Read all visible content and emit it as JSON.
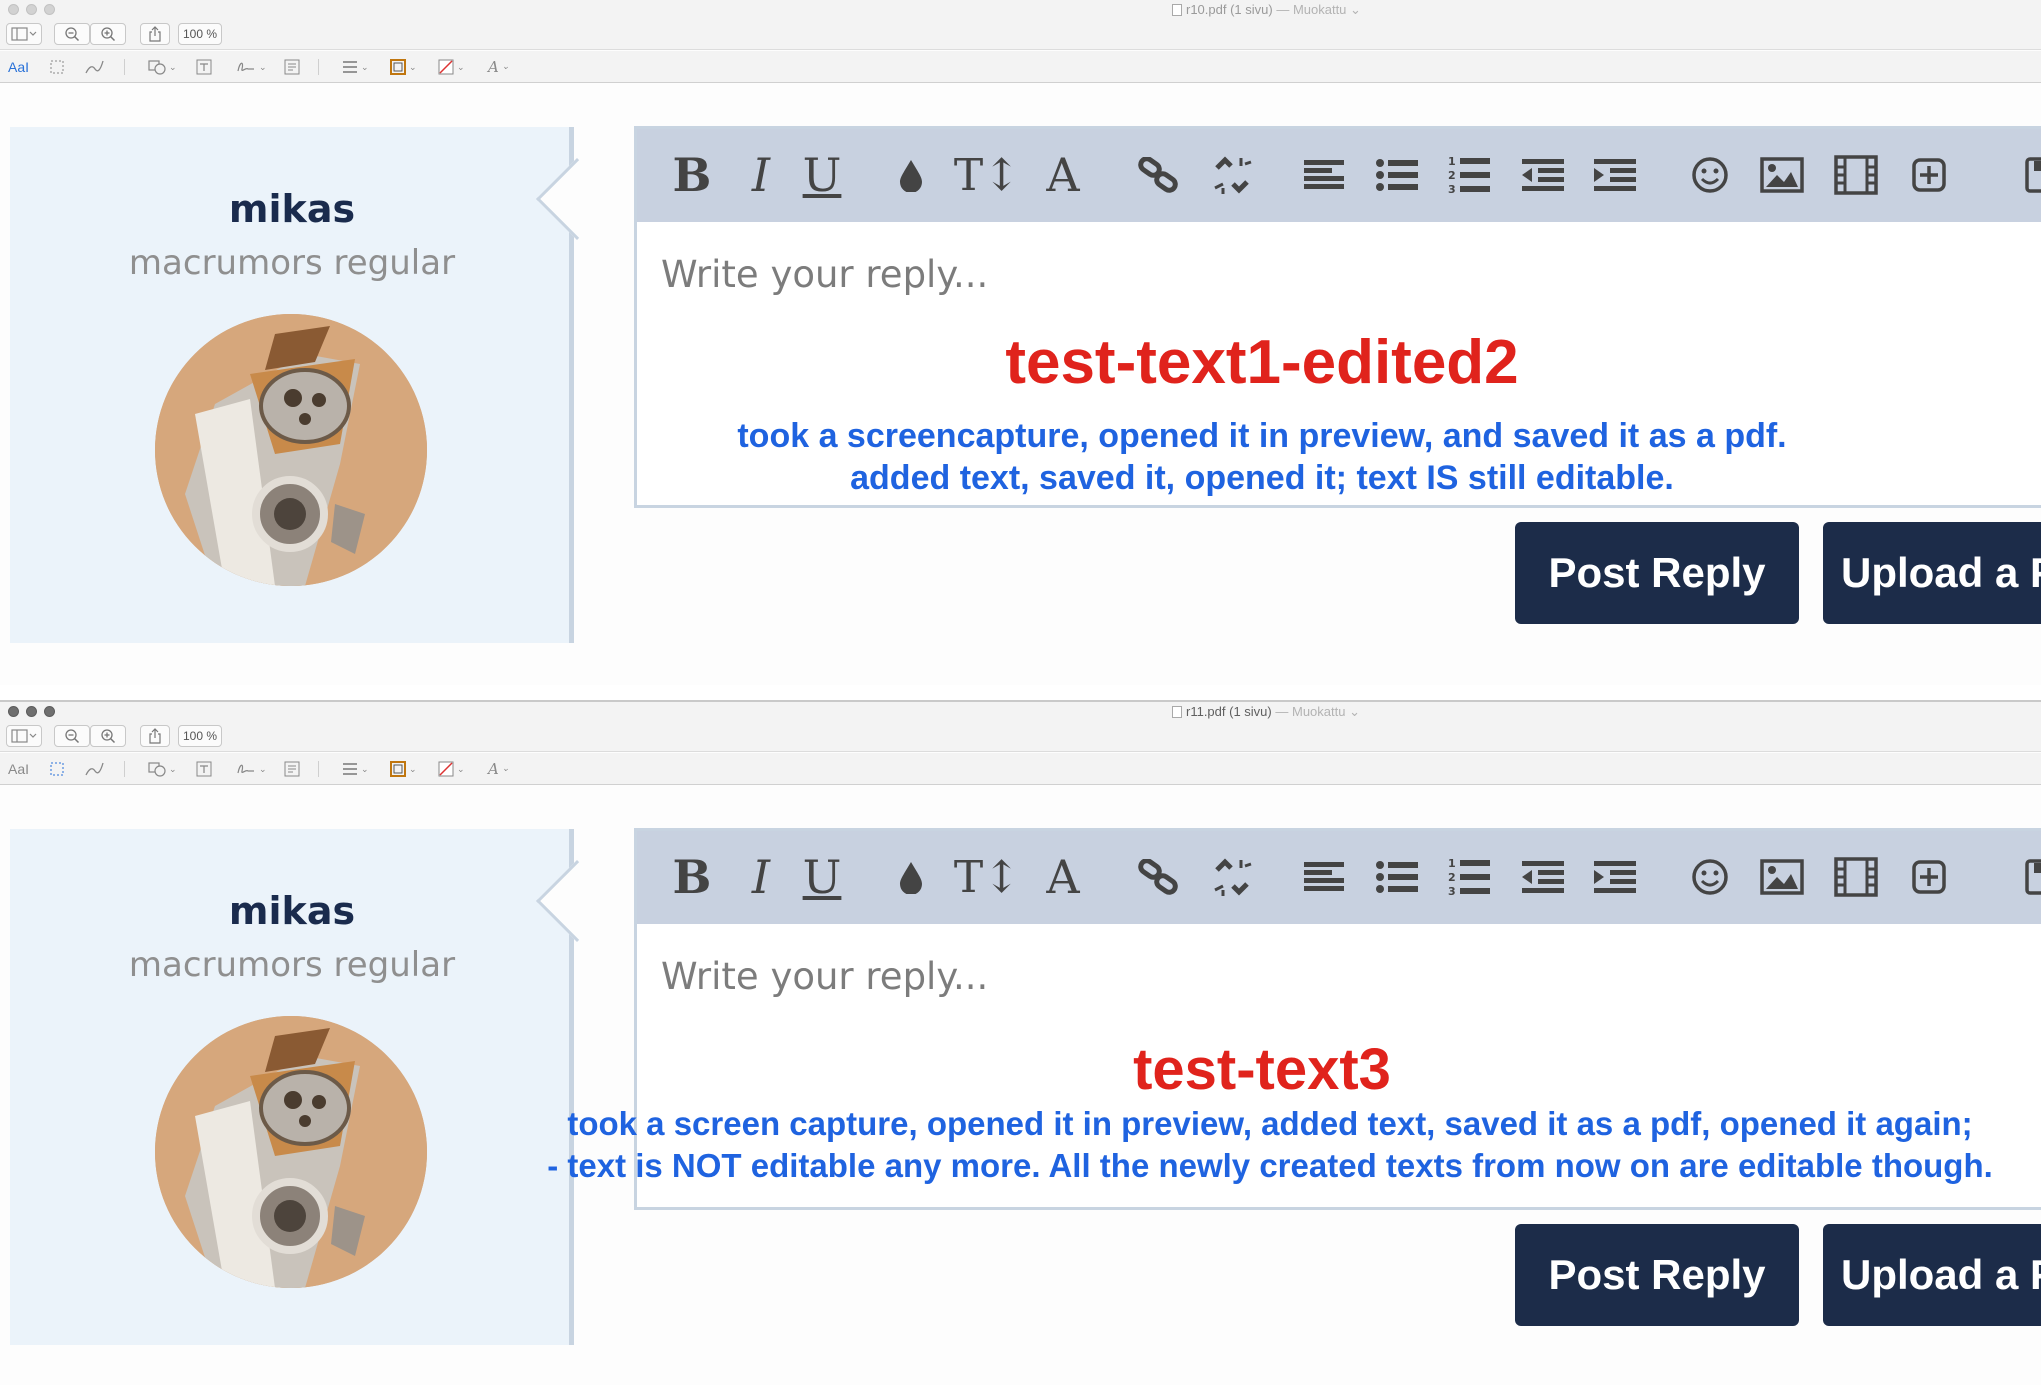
{
  "windows": [
    {
      "doc_title": "r10.pdf (1 sivu)",
      "doc_status": "— Muokattu",
      "zoom": "100 %",
      "markup_text_tool": "AaI",
      "user": {
        "name": "mikas",
        "title": "macrumors regular"
      },
      "editor": {
        "placeholder": "Write your reply..."
      },
      "overlay": {
        "heading": "test-text1-edited2",
        "lines": [
          "took a screencapture, opened it in preview, and saved it as a pdf.",
          "added text, saved it, opened it; text IS still editable."
        ]
      },
      "buttons": {
        "post": "Post Reply",
        "upload": "Upload a F"
      }
    },
    {
      "doc_title": "r11.pdf (1 sivu)",
      "doc_status": "— Muokattu",
      "zoom": "100 %",
      "markup_text_tool": "AaI",
      "user": {
        "name": "mikas",
        "title": "macrumors regular"
      },
      "editor": {
        "placeholder": "Write your reply..."
      },
      "overlay": {
        "heading": "test-text3",
        "lines": [
          "took a screen capture, opened it in preview, added text, saved it as a pdf, opened it again;",
          "- text is NOT editable any more. All the newly created texts from now on are editable though."
        ]
      },
      "buttons": {
        "post": "Post Reply",
        "upload": "Upload a F"
      }
    }
  ],
  "editor_toolbar_icons": [
    "bold-icon",
    "italic-icon",
    "underline-icon",
    "color-drop-icon",
    "font-size-icon",
    "font-icon",
    "link-icon",
    "unlink-icon",
    "align-icon",
    "bullet-list-icon",
    "numbered-list-icon",
    "outdent-icon",
    "indent-icon",
    "smiley-icon",
    "image-icon",
    "media-icon",
    "insert-icon",
    "save-icon"
  ],
  "colors": {
    "accent_red": "#e0231c",
    "accent_blue": "#1f63e0",
    "button_bg": "#1c2c49",
    "toolbar_bg": "#c8d1e0",
    "panel_bg": "#ebf3fa"
  }
}
